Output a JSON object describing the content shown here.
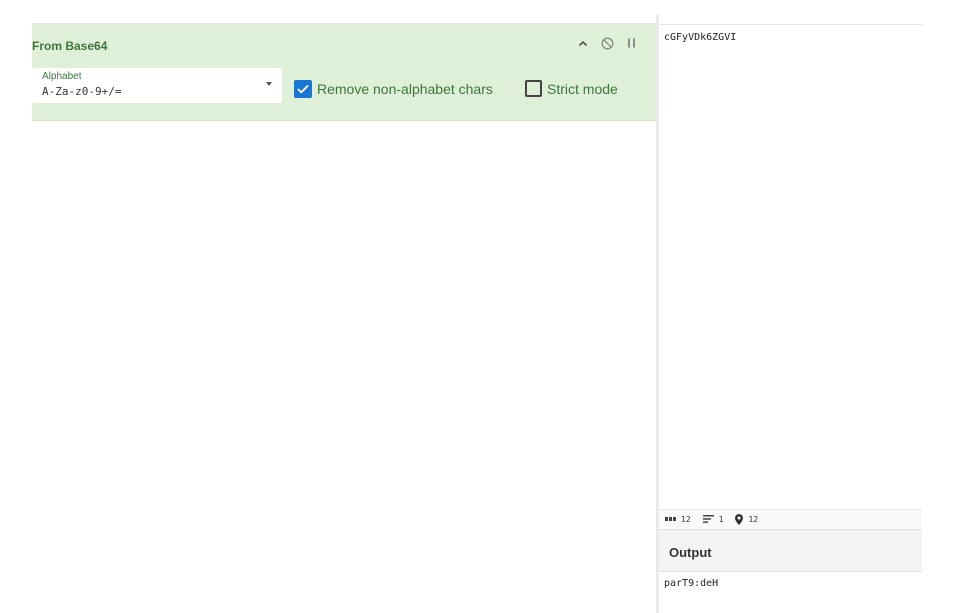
{
  "recipe": {
    "operation": {
      "title": "From Base64",
      "alphabet": {
        "label": "Alphabet",
        "value": "A-Za-z0-9+/="
      },
      "remove_non_alphabet": {
        "label": "Remove non-alphabet chars",
        "checked": true
      },
      "strict_mode": {
        "label": "Strict mode",
        "checked": false
      },
      "controls": [
        "chevron-up-icon",
        "disable-icon",
        "pause-icon"
      ]
    }
  },
  "input": {
    "text": "cGFyVDk6ZGVI",
    "status": {
      "chars": "12",
      "lines": "1",
      "position": "12"
    }
  },
  "output": {
    "title": "Output",
    "text": "parT9:deH"
  },
  "colors": {
    "operation_bg": "#dff0d8",
    "operation_text": "#3c763d",
    "checkbox_checked": "#1976d2"
  }
}
